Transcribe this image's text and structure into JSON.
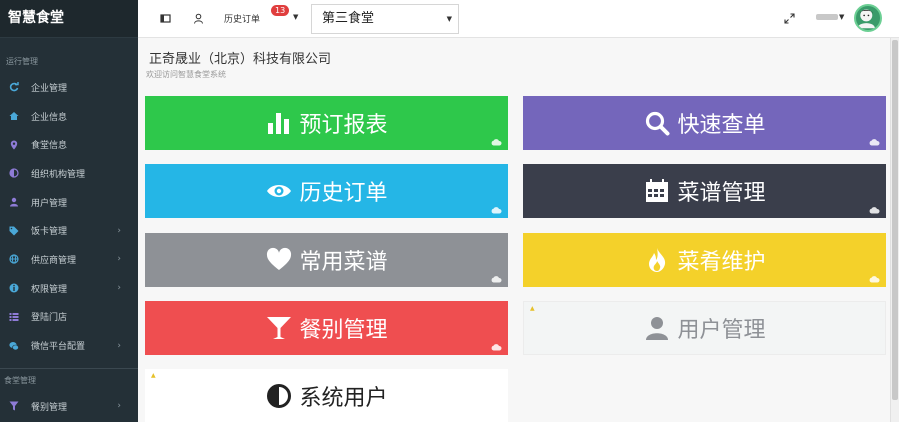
{
  "app": {
    "title": "智慧食堂"
  },
  "sidebar": {
    "section1": "运行管理",
    "items": [
      {
        "label": "企业管理",
        "icon": "refresh-icon",
        "chevron": false
      },
      {
        "label": "企业信息",
        "icon": "home-icon",
        "chevron": false
      },
      {
        "label": "食堂信息",
        "icon": "location-icon",
        "chevron": false
      },
      {
        "label": "组织机构管理",
        "icon": "half-circle-icon",
        "chevron": false
      },
      {
        "label": "用户管理",
        "icon": "user-icon",
        "chevron": false
      },
      {
        "label": "饭卡管理",
        "icon": "tag-icon",
        "chevron": true
      },
      {
        "label": "供应商管理",
        "icon": "globe-icon",
        "chevron": true
      },
      {
        "label": "权限管理",
        "icon": "info-icon",
        "chevron": true
      },
      {
        "label": "登陆门店",
        "icon": "list-icon",
        "chevron": false
      },
      {
        "label": "微信平台配置",
        "icon": "wechat-icon",
        "chevron": true
      }
    ],
    "section2": "食堂管理",
    "bottom_item": {
      "label": "餐别管理",
      "icon": "filter-icon",
      "chevron": true
    }
  },
  "topbar": {
    "history_label": "历史订单",
    "badge": "13",
    "canteen_value": "第三食堂"
  },
  "header": {
    "company": "正奇晟业（北京）科技有限公司",
    "welcome": "欢迎访问智慧食堂系统"
  },
  "tiles": [
    {
      "label": "预订报表",
      "icon": "bar-chart-icon"
    },
    {
      "label": "快速查单",
      "icon": "search-icon"
    },
    {
      "label": "历史订单",
      "icon": "eye-icon"
    },
    {
      "label": "菜谱管理",
      "icon": "calendar-icon"
    },
    {
      "label": "常用菜谱",
      "icon": "heart-icon"
    },
    {
      "label": "菜肴维护",
      "icon": "fire-icon"
    },
    {
      "label": "餐别管理",
      "icon": "cocktail-icon"
    },
    {
      "label": "用户管理",
      "icon": "user-icon"
    },
    {
      "label": "系统用户",
      "icon": "contrast-icon"
    }
  ],
  "colors": {
    "sidebar_bg": "#243037",
    "green": "#2ec84b",
    "purple": "#7466bb",
    "blue": "#25b6e6",
    "dark": "#3a3e4b",
    "gray": "#8e9196",
    "yellow": "#f4d12a",
    "red": "#ef4e50",
    "badge": "#e03e3e"
  }
}
